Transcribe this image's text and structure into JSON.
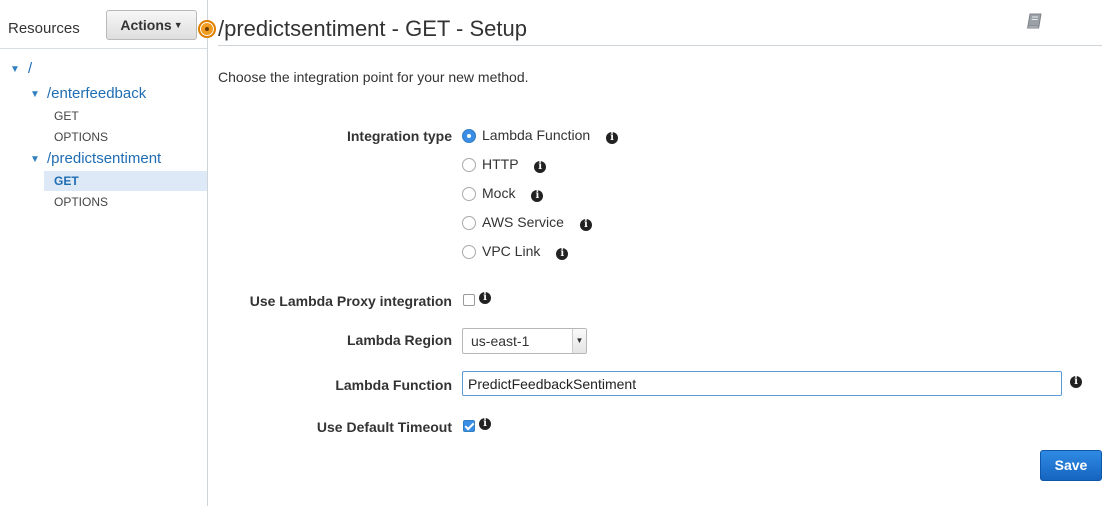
{
  "sidebar": {
    "title": "Resources",
    "actions_label": "Actions",
    "tree": {
      "root": "/",
      "res1": {
        "path": "/enterfeedback",
        "methods": [
          "GET",
          "OPTIONS"
        ]
      },
      "res2": {
        "path": "/predictsentiment",
        "methods": [
          "GET",
          "OPTIONS"
        ],
        "selected": "GET"
      }
    }
  },
  "main": {
    "title": "/predictsentiment - GET - Setup",
    "intro": "Choose the integration point for your new method.",
    "integration_type": {
      "label": "Integration type",
      "options": [
        "Lambda Function",
        "HTTP",
        "Mock",
        "AWS Service",
        "VPC Link"
      ],
      "selected": "Lambda Function"
    },
    "proxy": {
      "label": "Use Lambda Proxy integration",
      "checked": false
    },
    "region": {
      "label": "Lambda Region",
      "value": "us-east-1"
    },
    "function": {
      "label": "Lambda Function",
      "value": "PredictFeedbackSentiment"
    },
    "timeout": {
      "label": "Use Default Timeout",
      "checked": true
    },
    "save_label": "Save",
    "info_glyph": "i"
  },
  "colors": {
    "accent": "#1f6db3",
    "primary_button": "#1d74d2",
    "handle": "#f29b21"
  },
  "icons": [
    "caret-down-icon",
    "book-icon",
    "info-icon",
    "tree-expand-icon"
  ]
}
